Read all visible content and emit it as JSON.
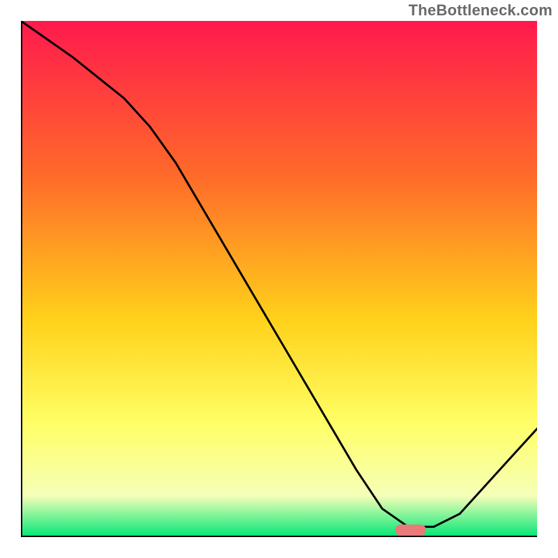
{
  "watermark": "TheBottleneck.com",
  "gradient": {
    "top": "#ff1a4d",
    "mid1": "#ff6a2a",
    "mid2": "#ffd21a",
    "mid3": "#ffff66",
    "mid4": "#f6ffb8",
    "bottom": "#00e676"
  },
  "axis_color": "#000000",
  "marker_color": "#e87a7a",
  "chart_data": {
    "type": "line",
    "title": "",
    "xlabel": "",
    "ylabel": "",
    "x": [
      0.0,
      0.05,
      0.1,
      0.15,
      0.2,
      0.25,
      0.3,
      0.35,
      0.4,
      0.45,
      0.5,
      0.55,
      0.6,
      0.65,
      0.7,
      0.75,
      0.8,
      0.85,
      0.9,
      0.95,
      1.0
    ],
    "values": [
      1.0,
      0.965,
      0.93,
      0.89,
      0.85,
      0.795,
      0.725,
      0.64,
      0.555,
      0.47,
      0.385,
      0.3,
      0.215,
      0.13,
      0.055,
      0.02,
      0.02,
      0.045,
      0.1,
      0.155,
      0.21
    ],
    "xlim": [
      0,
      1
    ],
    "ylim": [
      0,
      1
    ],
    "marker_x": 0.755,
    "marker_w": 0.06,
    "annotations": []
  }
}
